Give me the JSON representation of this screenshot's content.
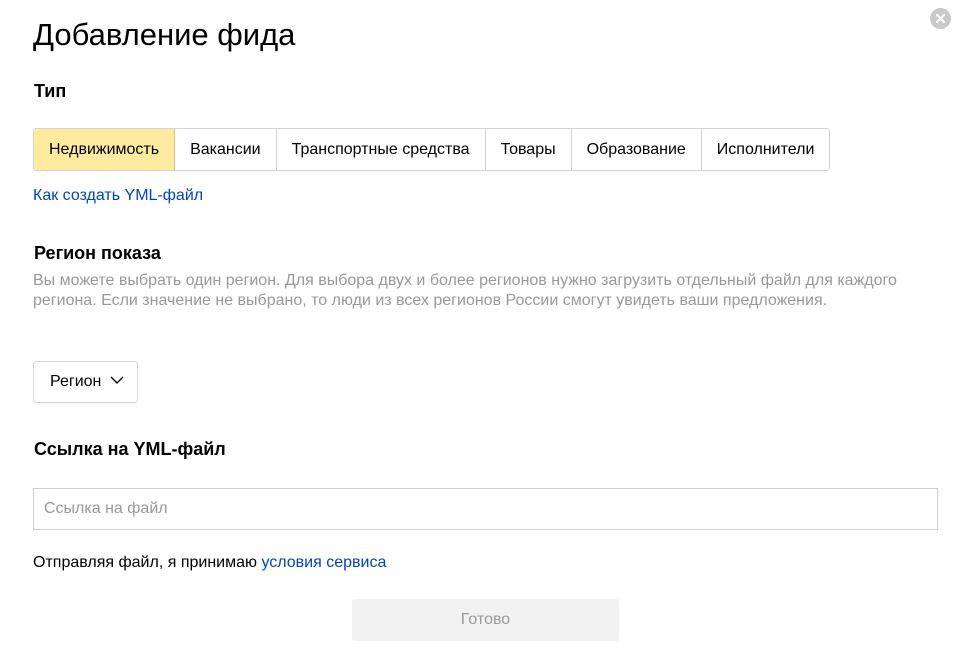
{
  "dialog": {
    "title": "Добавление фида",
    "close_icon": "close-circle-icon"
  },
  "type_section": {
    "heading": "Тип",
    "options": [
      {
        "label": "Недвижимость",
        "selected": true
      },
      {
        "label": "Вакансии",
        "selected": false
      },
      {
        "label": "Транспортные средства",
        "selected": false
      },
      {
        "label": "Товары",
        "selected": false
      },
      {
        "label": "Образование",
        "selected": false
      },
      {
        "label": "Исполнители",
        "selected": false
      }
    ],
    "help_link": "Как создать YML-файл"
  },
  "region_section": {
    "heading": "Регион показа",
    "description": "Вы можете выбрать один регион. Для выбора двух и более регионов нужно загрузить отдельный файл для каждого региона. Если значение не выбрано, то люди из всех регионов России смогут увидеть ваши предложения.",
    "select_label": "Регион",
    "select_icon": "chevron-down-icon"
  },
  "link_section": {
    "heading": "Ссылка на YML-файл",
    "input_value": "",
    "input_placeholder": "Ссылка на файл"
  },
  "terms": {
    "text": "Отправляя файл, я принимаю ",
    "link": "условия сервиса"
  },
  "submit": {
    "label": "Готово",
    "disabled": true
  },
  "colors": {
    "selected_segment": "#ffeba0",
    "link": "#0044bb",
    "muted_text": "#999999",
    "disabled_button": "#f2f2f2"
  }
}
